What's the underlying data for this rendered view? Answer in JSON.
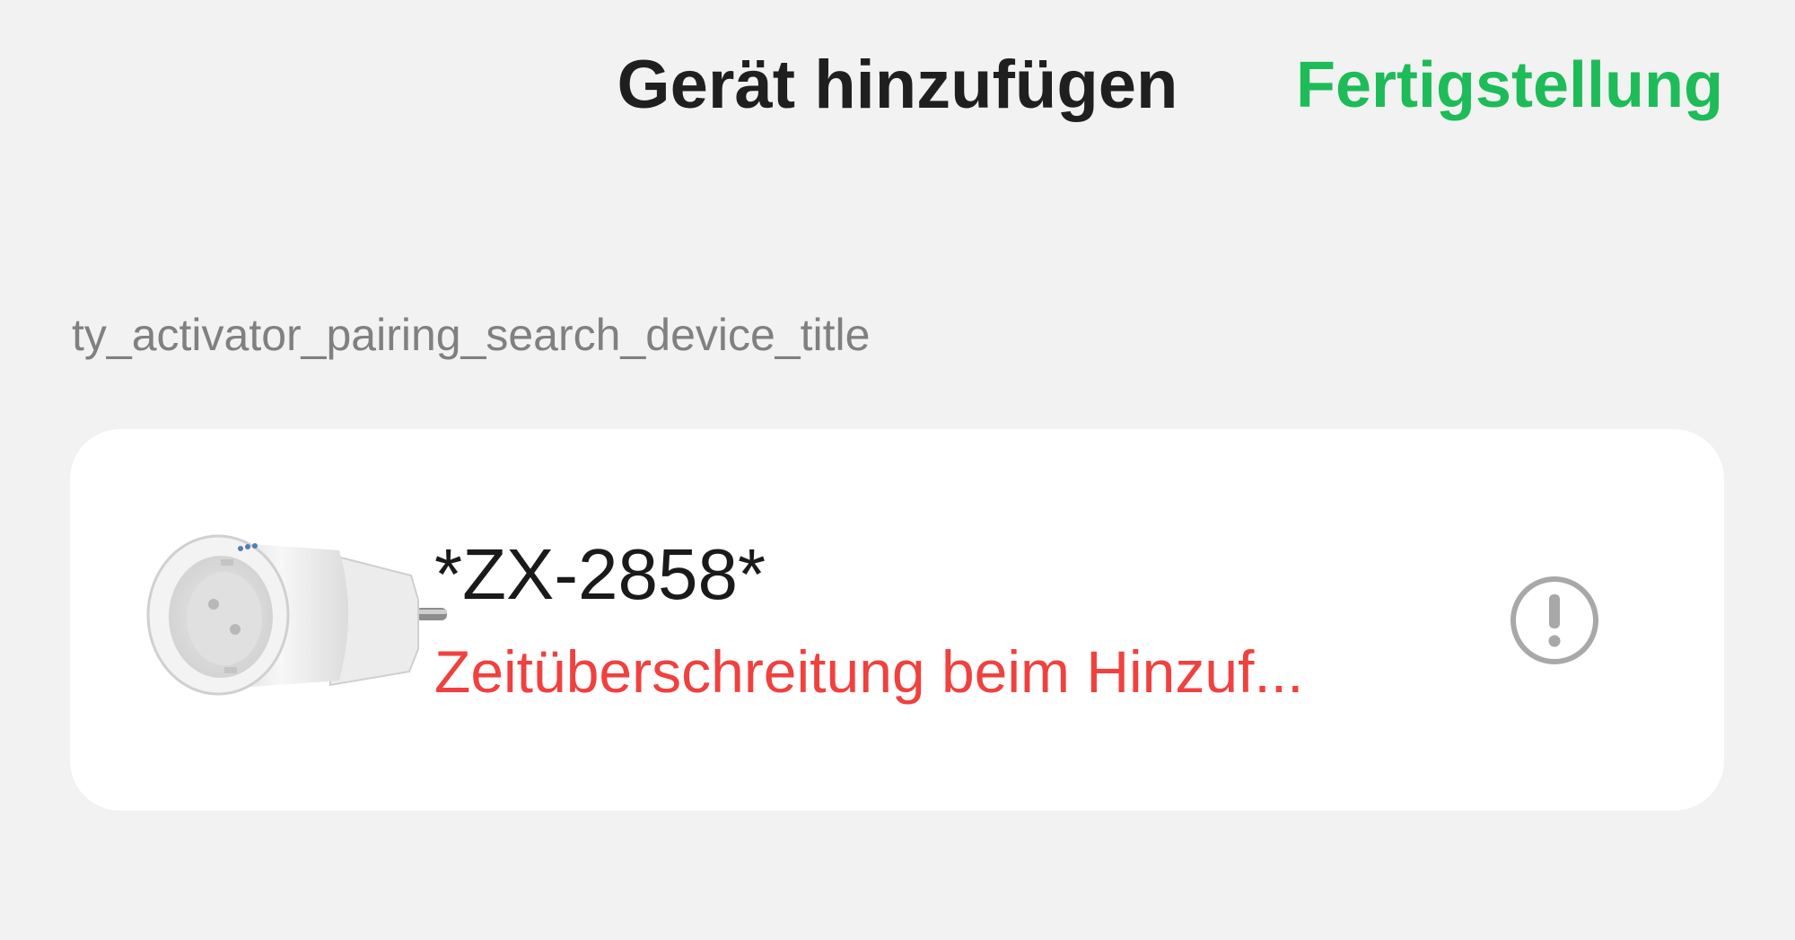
{
  "header": {
    "title": "Gerät hinzufügen",
    "done_label": "Fertigstellung"
  },
  "section": {
    "label": "ty_activator_pairing_search_device_title"
  },
  "device": {
    "name": "*ZX-2858*",
    "status": "Zeitüberschreitung beim Hinzuf...",
    "image": "smart-plug-image",
    "status_icon": "exclamation-circle-icon"
  },
  "colors": {
    "background": "#f2f2f2",
    "accent": "#1dbc58",
    "error": "#f0413f",
    "card": "#ffffff",
    "icon_gray": "#a8a8a8"
  }
}
